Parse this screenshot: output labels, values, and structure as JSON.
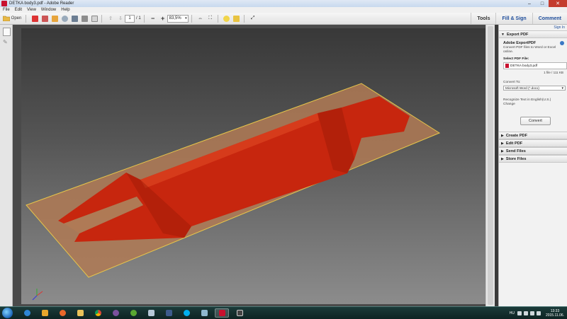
{
  "window": {
    "title": "DETKA body3.pdf - Adobe Reader",
    "minimize": "–",
    "maximize": "□",
    "close": "✕"
  },
  "menu": [
    "File",
    "Edit",
    "View",
    "Window",
    "Help"
  ],
  "toolbar": {
    "open_label": "Open",
    "page_number": "1",
    "page_total": "/ 1",
    "zoom": "83,5%",
    "tools": "Tools",
    "fill_sign": "Fill & Sign",
    "comment": "Comment"
  },
  "right_pane": {
    "sign_in": "Sign In",
    "export_pdf": {
      "header": "Export PDF",
      "service_title": "Adobe ExportPDF",
      "description": "Convert PDF files to Word or Excel online.",
      "select_label": "Select PDF File:",
      "file_name": "DETKA body3.pdf",
      "page_count": "1 file / 111 KB",
      "convert_to_label": "Convert To:",
      "convert_to_value": "Microsoft Word (*.docx)",
      "recognize_text": "Recognize Text in English(U.S.)",
      "change_link": "Change",
      "convert_button": "Convert"
    },
    "sections": [
      "Create PDF",
      "Edit PDF",
      "Send Files",
      "Store Files"
    ]
  },
  "tray": {
    "lang": "HU",
    "time": "13:33",
    "date": "2015.11.06."
  },
  "colors": {
    "part_red": "#c7260e",
    "plane_fill": "#b07a55",
    "plane_edge": "#e7c64a",
    "accent_blue": "#1f4e9c"
  }
}
